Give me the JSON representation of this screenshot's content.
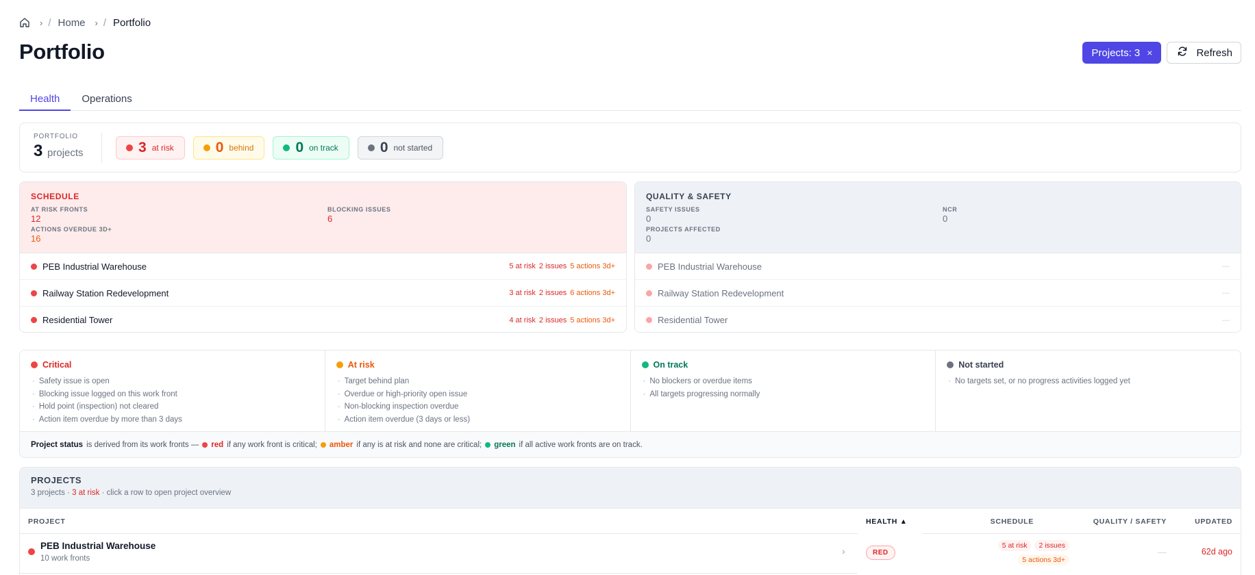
{
  "breadcrumb": {
    "home_icon": "home-icon",
    "items": [
      "Home",
      "Portfolio"
    ]
  },
  "page": {
    "title": "Portfolio"
  },
  "header": {
    "filter_label": "Projects: 3",
    "filter_clear": "×",
    "refresh_label": "Refresh"
  },
  "tabs": [
    {
      "label": "Health",
      "active": true
    },
    {
      "label": "Operations",
      "active": false
    }
  ],
  "summary": {
    "label": "PORTFOLIO",
    "count": "3",
    "unit": "projects",
    "pills": [
      {
        "num": "3",
        "label": "at risk",
        "tone": "red"
      },
      {
        "num": "0",
        "label": "behind",
        "tone": "amber"
      },
      {
        "num": "0",
        "label": "on track",
        "tone": "green"
      },
      {
        "num": "0",
        "label": "not started",
        "tone": "gray"
      }
    ]
  },
  "schedule": {
    "title": "SCHEDULE",
    "stats": [
      {
        "key": "AT RISK FRONTS",
        "value": "12"
      },
      {
        "key": "BLOCKING ISSUES",
        "value": "6"
      },
      {
        "key": "ACTIONS OVERDUE 3D+",
        "value": "16"
      }
    ],
    "rows": [
      {
        "name": "PEB Industrial Warehouse",
        "at_risk": "5 at risk",
        "issues": "2 issues",
        "actions": "5 actions 3d+"
      },
      {
        "name": "Railway Station Redevelopment",
        "at_risk": "3 at risk",
        "issues": "2 issues",
        "actions": "6 actions 3d+"
      },
      {
        "name": "Residential Tower",
        "at_risk": "4 at risk",
        "issues": "2 issues",
        "actions": "5 actions 3d+"
      }
    ]
  },
  "quality": {
    "title": "QUALITY & SAFETY",
    "stats": [
      {
        "key": "SAFETY ISSUES",
        "value": "0"
      },
      {
        "key": "NCR",
        "value": "0"
      },
      {
        "key": "PROJECTS AFFECTED",
        "value": "0"
      }
    ],
    "rows": [
      {
        "name": "PEB Industrial Warehouse",
        "value": "—"
      },
      {
        "name": "Railway Station Redevelopment",
        "value": "—"
      },
      {
        "name": "Residential Tower",
        "value": "—"
      }
    ]
  },
  "legend": {
    "columns": [
      {
        "title": "Critical",
        "items": [
          "Safety issue is open",
          "Blocking issue logged on this work front",
          "Hold point (inspection) not cleared",
          "Action item overdue by more than 3 days"
        ]
      },
      {
        "title": "At risk",
        "items": [
          "Target behind plan",
          "Overdue or high-priority open issue",
          "Non-blocking inspection overdue",
          "Action item overdue (3 days or less)"
        ]
      },
      {
        "title": "On track",
        "items": [
          "No blockers or overdue items",
          "All targets progressing normally"
        ]
      },
      {
        "title": "Not started",
        "items": [
          "No targets set, or no progress activities logged yet"
        ]
      }
    ],
    "footer": {
      "lead": "Project status",
      "t1": "is derived from its work fronts —",
      "red": "red",
      "t2": "if any work front is critical;",
      "amber": "amber",
      "t3": "if any is at risk and none are critical;",
      "green": "green",
      "t4": "if all active work fronts are on track."
    }
  },
  "projects": {
    "title": "PROJECTS",
    "sub_count": "3 projects",
    "sub_sep1": "·",
    "sub_risk": "3 at risk",
    "sub_hint": "· click a row to open project overview",
    "columns": {
      "project": "PROJECT",
      "health": "HEALTH ▲",
      "schedule": "SCHEDULE",
      "quality": "QUALITY / SAFETY",
      "updated": "UPDATED"
    },
    "rows": [
      {
        "name": "PEB Industrial Warehouse",
        "fronts": "10 work fronts",
        "health": "RED",
        "at_risk": "5 at risk",
        "issues": "2 issues",
        "actions": "5 actions 3d+",
        "quality": "—",
        "updated": "62d ago"
      }
    ]
  },
  "colors": {
    "accent": "#4f46e5",
    "red": "#dc2626",
    "amber": "#ea580c",
    "green": "#047857"
  }
}
